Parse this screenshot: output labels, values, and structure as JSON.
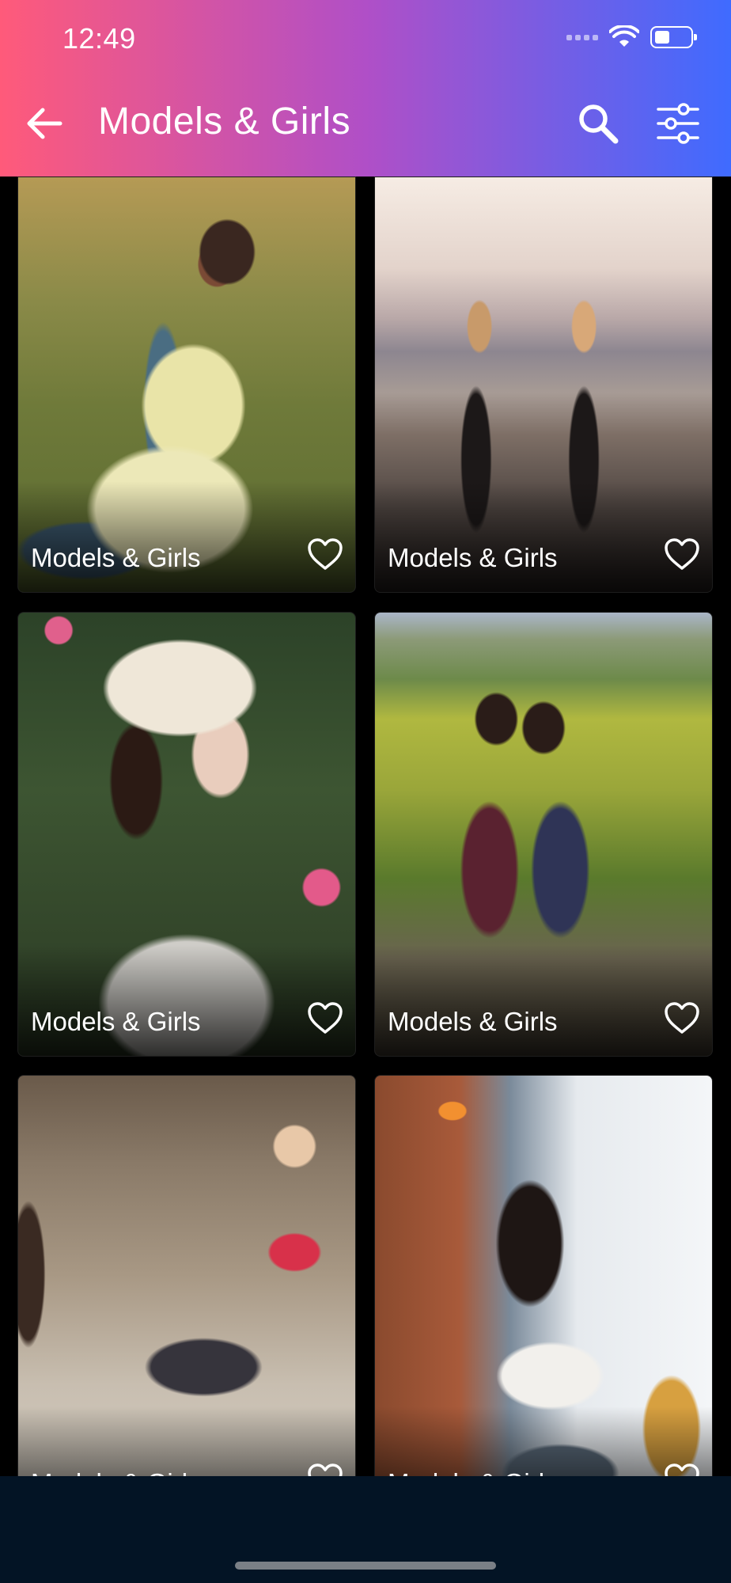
{
  "status_bar": {
    "time": "12:49",
    "battery_level": 0.35
  },
  "header": {
    "title": "Models & Girls",
    "gradient": [
      "#ff5a7a",
      "#b04fc7",
      "#3f6bff"
    ],
    "back_icon": "arrow-left-icon",
    "search_icon": "search-icon",
    "filter_icon": "sliders-icon"
  },
  "cards": [
    {
      "label": "Models & Girls",
      "favorite": false,
      "image": "woman in yellow dress seated on grass"
    },
    {
      "label": "Models & Girls",
      "favorite": false,
      "image": "two women walking on beach"
    },
    {
      "label": "Models & Girls",
      "favorite": false,
      "image": "woman in white sun hat among pink flowers"
    },
    {
      "label": "Models & Girls",
      "favorite": false,
      "image": "two women sitting on log in green field"
    },
    {
      "label": "Models & Girls",
      "favorite": false,
      "image": "woman in red sports top exercising in gym"
    },
    {
      "label": "Models & Girls",
      "favorite": false,
      "image": "woman in white t-shirt at cafe window"
    }
  ],
  "bottom_bar_color": "#031425"
}
